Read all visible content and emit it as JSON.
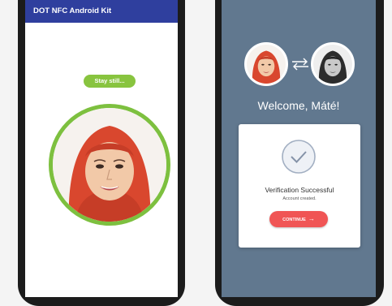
{
  "left_screen": {
    "app_title": "DOT NFC Android Kit",
    "status_pill": "Stay still...",
    "ring_color": "#7dc03f"
  },
  "right_screen": {
    "welcome_text": "Welcome, Máté!",
    "card": {
      "title": "Verification Successful",
      "subtitle": "Account created.",
      "button_label": "CONTINUE",
      "button_icon": "arrow-right-icon"
    },
    "background_color": "#61788f",
    "accent_color": "#f05555"
  }
}
